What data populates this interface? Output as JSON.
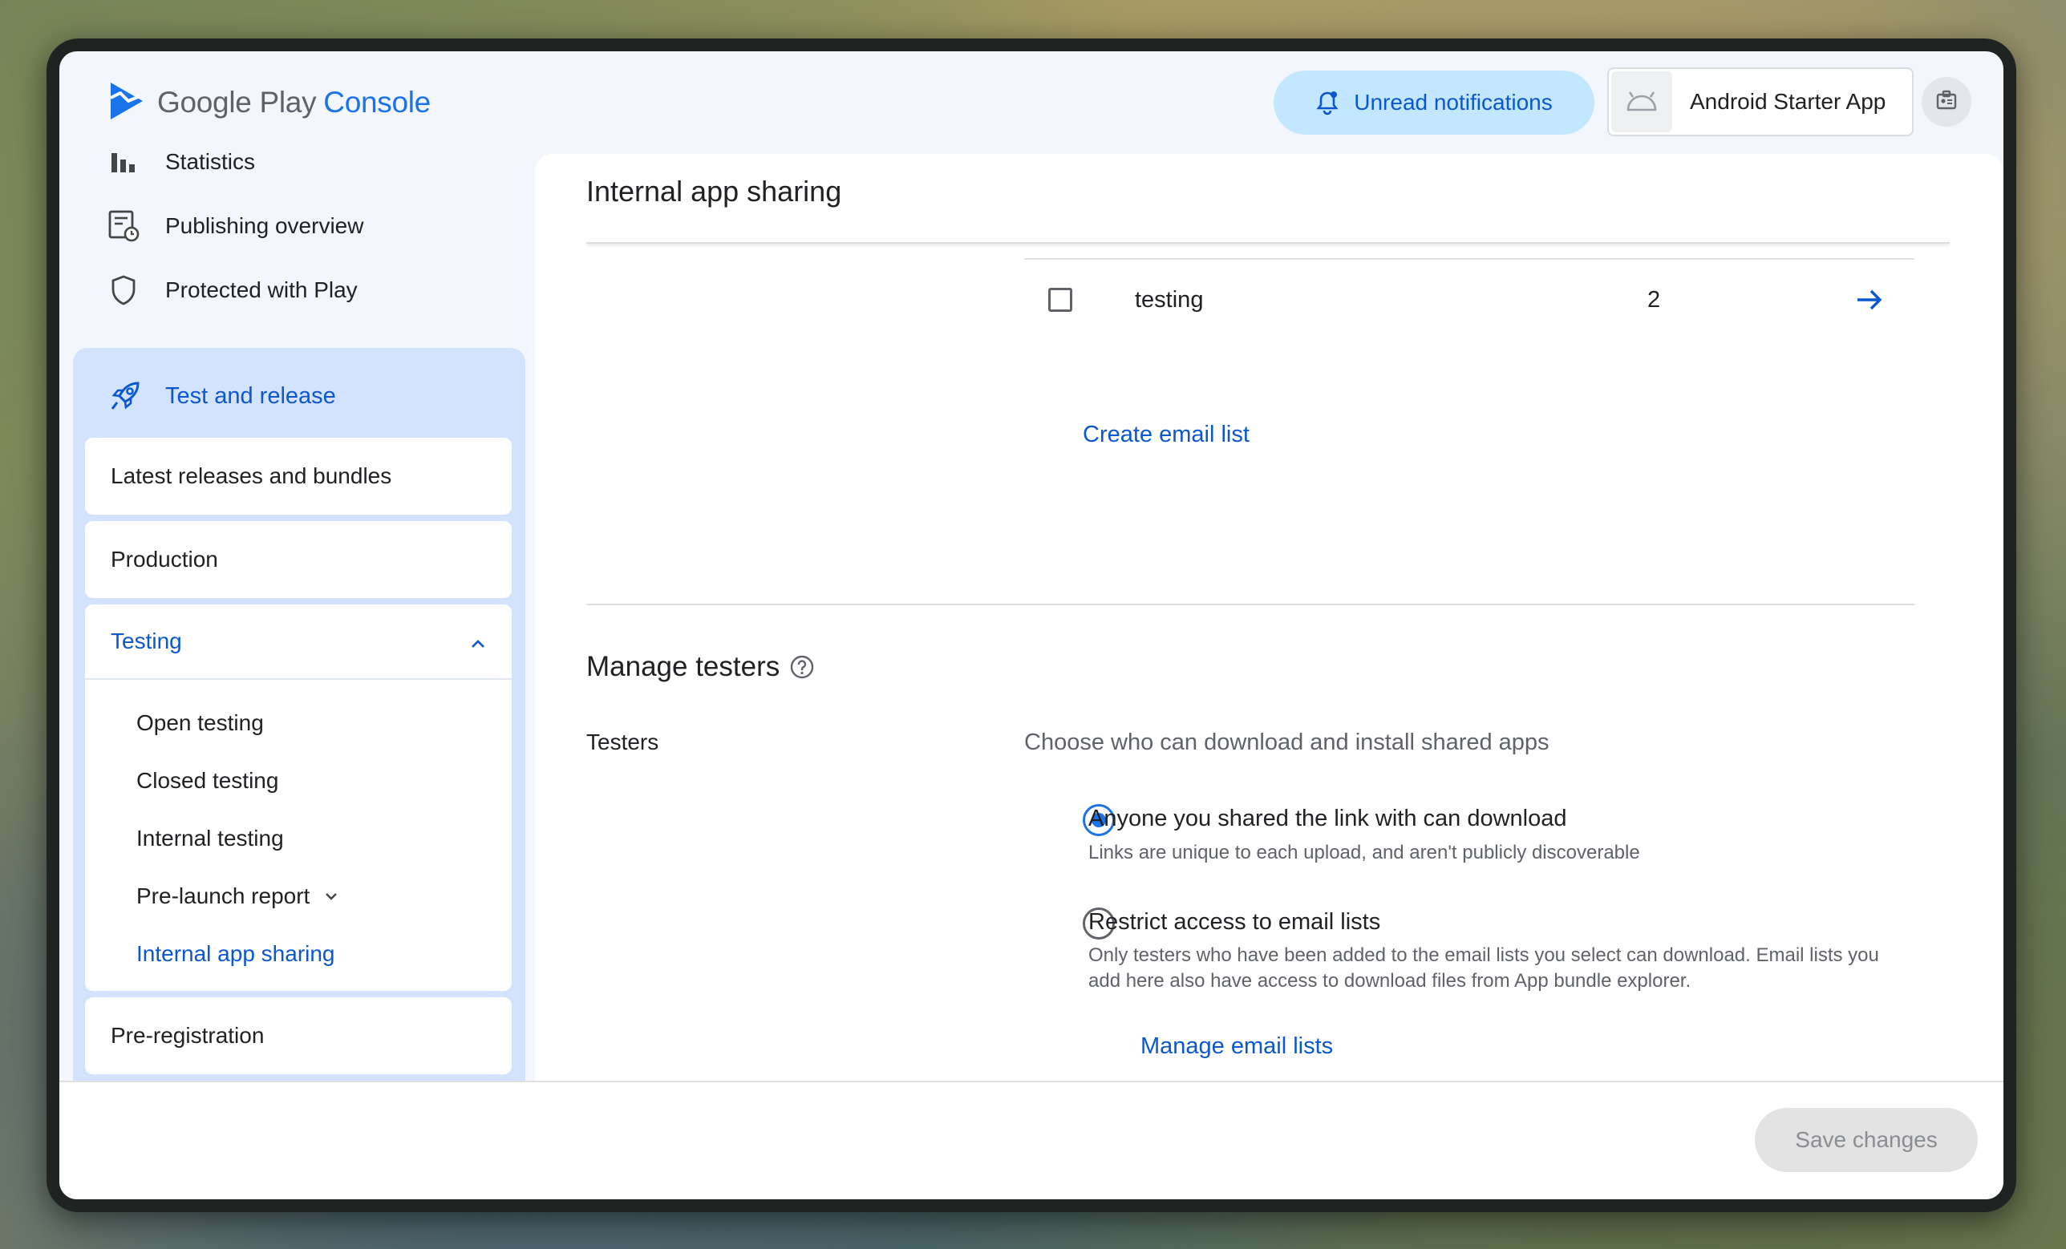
{
  "header": {
    "logo_text_primary": "Google Play",
    "logo_text_accent": "Console",
    "notifications_label": "Unread notifications",
    "app_name": "Android Starter App"
  },
  "sidebar": {
    "top_items": [
      {
        "label": "Statistics",
        "icon": "bar-chart-icon"
      },
      {
        "label": "Publishing overview",
        "icon": "publishing-overview-icon"
      },
      {
        "label": "Protected with Play",
        "icon": "shield-icon"
      }
    ],
    "test_and_release": {
      "label": "Test and release",
      "icon": "rocket-icon",
      "items": [
        {
          "label": "Latest releases and bundles"
        },
        {
          "label": "Production"
        }
      ],
      "testing": {
        "label": "Testing",
        "expanded": true,
        "children": [
          {
            "label": "Open testing"
          },
          {
            "label": "Closed testing"
          },
          {
            "label": "Internal testing"
          },
          {
            "label": "Pre-launch report"
          },
          {
            "label": "Internal app sharing",
            "active": true
          }
        ]
      },
      "after_items": [
        {
          "label": "Pre-registration"
        }
      ]
    }
  },
  "main": {
    "page_title": "Internal app sharing",
    "email_list_row": {
      "name": "testing",
      "count": "2"
    },
    "create_email_list_label": "Create email list",
    "manage_testers": {
      "title": "Manage testers",
      "field_label": "Testers",
      "field_description": "Choose who can download and install shared apps",
      "options": [
        {
          "title": "Anyone you shared the link with can download",
          "description": "Links are unique to each upload, and aren't publicly discoverable",
          "selected": true
        },
        {
          "title": "Restrict access to email lists",
          "description": "Only testers who have been added to the email lists you select can download. Email lists you add here also have access to download files from App bundle explorer.",
          "selected": false
        }
      ],
      "manage_email_lists_label": "Manage email lists"
    }
  },
  "footer": {
    "save_label": "Save changes"
  },
  "colors": {
    "accent": "#1a73e8",
    "link": "#0b57d0",
    "nav_active_bg": "#d3e3fd",
    "notifications_bg": "#c2e7ff"
  }
}
